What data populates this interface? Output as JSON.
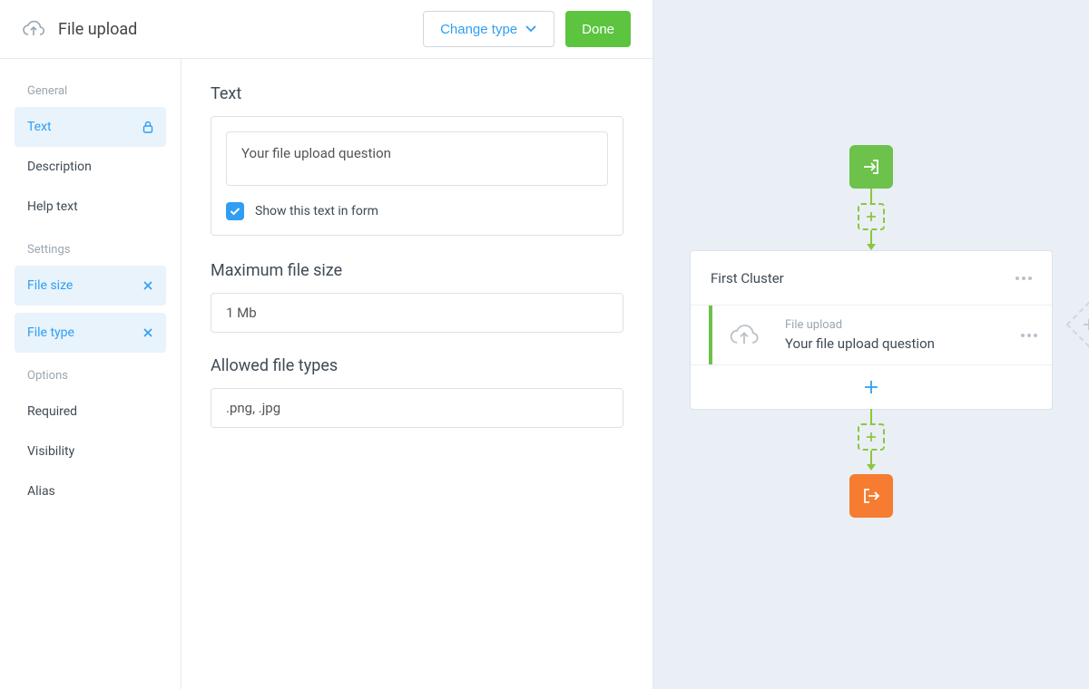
{
  "header": {
    "title": "File upload",
    "change_type": "Change type",
    "done": "Done"
  },
  "sidebar": {
    "general_label": "General",
    "general": {
      "text": "Text",
      "description": "Description",
      "help_text": "Help text"
    },
    "settings_label": "Settings",
    "settings": {
      "file_size": "File size",
      "file_type": "File type"
    },
    "options_label": "Options",
    "options": {
      "required": "Required",
      "visibility": "Visibility",
      "alias": "Alias"
    }
  },
  "form": {
    "text_title": "Text",
    "text_value": "Your file upload question",
    "show_in_form": "Show this text in form",
    "max_size_title": "Maximum file size",
    "max_size_value": "1 Mb",
    "allowed_title": "Allowed file types",
    "allowed_value": ".png, .jpg"
  },
  "flow": {
    "cluster_title": "First Cluster",
    "item_type": "File upload",
    "item_question": "Your file upload question"
  }
}
